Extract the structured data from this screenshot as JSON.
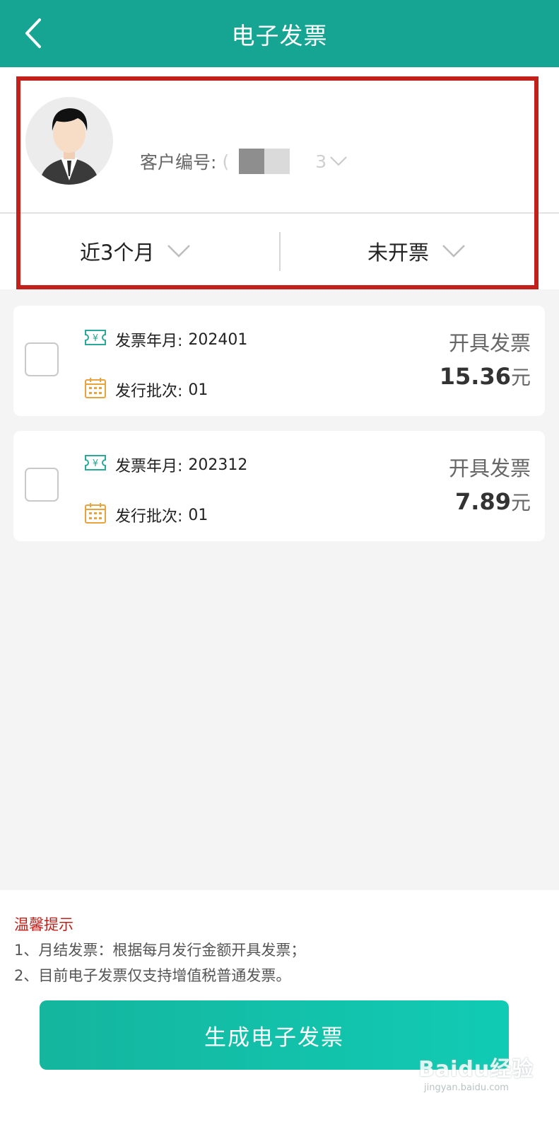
{
  "header": {
    "title": "电子发票"
  },
  "profile": {
    "customer_label": "客户编号:",
    "customer_prefix": "(",
    "customer_suffix": "3",
    "filters": {
      "period": "近3个月",
      "status": "未开票"
    }
  },
  "invoices": [
    {
      "year_month_label": "发票年月:",
      "year_month": "202401",
      "batch_label": "发行批次:",
      "batch": "01",
      "action": "开具发票",
      "amount": "15.36",
      "unit": "元"
    },
    {
      "year_month_label": "发票年月:",
      "year_month": "202312",
      "batch_label": "发行批次:",
      "batch": "01",
      "action": "开具发票",
      "amount": "7.89",
      "unit": "元"
    }
  ],
  "notice": {
    "title": "温馨提示",
    "lines": [
      "1、月结发票：根据每月发行金额开具发票；",
      "2、目前电子发票仅支持增值税普通发票。"
    ]
  },
  "generate_button": "生成电子发票",
  "watermark": {
    "brand": "Baidu经验",
    "url": "jingyan.baidu.com"
  },
  "colors": {
    "primary": "#17a593",
    "highlight": "#c2201b",
    "ticket_icon": "#2aa89a",
    "calendar_icon": "#e8a33c"
  }
}
